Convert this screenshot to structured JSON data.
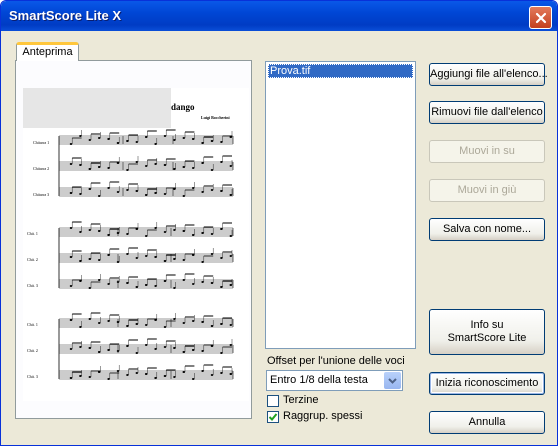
{
  "window": {
    "title": "SmartScore Lite X"
  },
  "tab": {
    "label": "Anteprima"
  },
  "preview": {
    "title": "dango",
    "composer": "Luigi Boccherini",
    "system1_labels": [
      "Chitarra 1",
      "Chitarra 2",
      "Chitarra 3"
    ],
    "system2_labels": [
      "Chit. 1",
      "Chit. 2",
      "Chit. 3"
    ],
    "system3_labels": [
      "Chit. 1",
      "Chit. 2",
      "Chit. 3"
    ]
  },
  "file_list": {
    "items": [
      "Prova.tif"
    ]
  },
  "buttons": {
    "add_files": "Aggiungi file all'elenco...",
    "remove_file": "Rimuovi file dall'elenco",
    "move_up": "Muovi in su",
    "move_down": "Muovi in giù",
    "save_as": "Salva con nome...",
    "info_line1": "Info su",
    "info_line2": "SmartScore Lite",
    "start_recognition": "Inizia riconoscimento",
    "cancel": "Annulla"
  },
  "offset": {
    "label": "Offset per l'unione delle voci",
    "selected": "Entro 1/8 della testa"
  },
  "options": {
    "terzine": {
      "label": "Terzine",
      "checked": false
    },
    "raggrup": {
      "label": "Raggrup. spessi",
      "checked": true
    }
  },
  "colors": {
    "title_bar": "#0054e3",
    "selection": "#316ac5",
    "tab_accent": "#ffc73c"
  }
}
